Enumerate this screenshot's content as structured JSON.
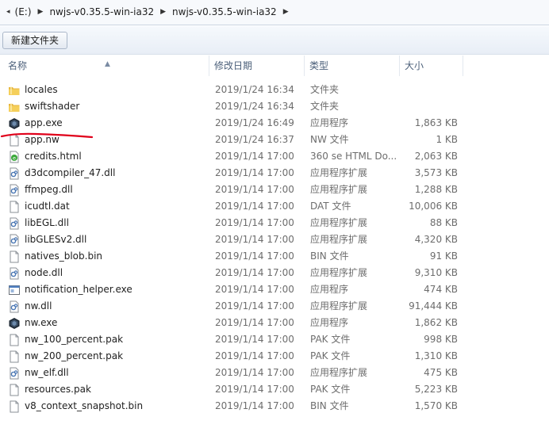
{
  "address": {
    "drive": "(E:)",
    "crumbs": [
      "nwjs-v0.35.5-win-ia32",
      "nwjs-v0.35.5-win-ia32"
    ]
  },
  "toolbar": {
    "new_folder_label": "新建文件夹"
  },
  "columns": {
    "name": "名称",
    "date": "修改日期",
    "type": "类型",
    "size": "大小"
  },
  "accent": {
    "annotation": "#e0001a"
  },
  "files": [
    {
      "name": "locales",
      "date": "2019/1/24 16:34",
      "type": "文件夹",
      "size": "",
      "icon": "folder-icon"
    },
    {
      "name": "swiftshader",
      "date": "2019/1/24 16:34",
      "type": "文件夹",
      "size": "",
      "icon": "folder-icon"
    },
    {
      "name": "app.exe",
      "date": "2019/1/24 16:49",
      "type": "应用程序",
      "size": "1,863 KB",
      "icon": "nwjs-app-icon"
    },
    {
      "name": "app.nw",
      "date": "2019/1/24 16:37",
      "type": "NW 文件",
      "size": "1 KB",
      "icon": "file-icon"
    },
    {
      "name": "credits.html",
      "date": "2019/1/14 17:00",
      "type": "360 se HTML Do...",
      "size": "2,063 KB",
      "icon": "html-icon"
    },
    {
      "name": "d3dcompiler_47.dll",
      "date": "2019/1/14 17:00",
      "type": "应用程序扩展",
      "size": "3,573 KB",
      "icon": "dll-icon"
    },
    {
      "name": "ffmpeg.dll",
      "date": "2019/1/14 17:00",
      "type": "应用程序扩展",
      "size": "1,288 KB",
      "icon": "dll-icon"
    },
    {
      "name": "icudtl.dat",
      "date": "2019/1/14 17:00",
      "type": "DAT 文件",
      "size": "10,006 KB",
      "icon": "file-icon"
    },
    {
      "name": "libEGL.dll",
      "date": "2019/1/14 17:00",
      "type": "应用程序扩展",
      "size": "88 KB",
      "icon": "dll-icon"
    },
    {
      "name": "libGLESv2.dll",
      "date": "2019/1/14 17:00",
      "type": "应用程序扩展",
      "size": "4,320 KB",
      "icon": "dll-icon"
    },
    {
      "name": "natives_blob.bin",
      "date": "2019/1/14 17:00",
      "type": "BIN 文件",
      "size": "91 KB",
      "icon": "file-icon"
    },
    {
      "name": "node.dll",
      "date": "2019/1/14 17:00",
      "type": "应用程序扩展",
      "size": "9,310 KB",
      "icon": "dll-icon"
    },
    {
      "name": "notification_helper.exe",
      "date": "2019/1/14 17:00",
      "type": "应用程序",
      "size": "474 KB",
      "icon": "exe-icon"
    },
    {
      "name": "nw.dll",
      "date": "2019/1/14 17:00",
      "type": "应用程序扩展",
      "size": "91,444 KB",
      "icon": "dll-icon"
    },
    {
      "name": "nw.exe",
      "date": "2019/1/14 17:00",
      "type": "应用程序",
      "size": "1,862 KB",
      "icon": "nwjs-app-icon"
    },
    {
      "name": "nw_100_percent.pak",
      "date": "2019/1/14 17:00",
      "type": "PAK 文件",
      "size": "998 KB",
      "icon": "file-icon"
    },
    {
      "name": "nw_200_percent.pak",
      "date": "2019/1/14 17:00",
      "type": "PAK 文件",
      "size": "1,310 KB",
      "icon": "file-icon"
    },
    {
      "name": "nw_elf.dll",
      "date": "2019/1/14 17:00",
      "type": "应用程序扩展",
      "size": "475 KB",
      "icon": "dll-icon"
    },
    {
      "name": "resources.pak",
      "date": "2019/1/14 17:00",
      "type": "PAK 文件",
      "size": "5,223 KB",
      "icon": "file-icon"
    },
    {
      "name": "v8_context_snapshot.bin",
      "date": "2019/1/14 17:00",
      "type": "BIN 文件",
      "size": "1,570 KB",
      "icon": "file-icon"
    }
  ]
}
